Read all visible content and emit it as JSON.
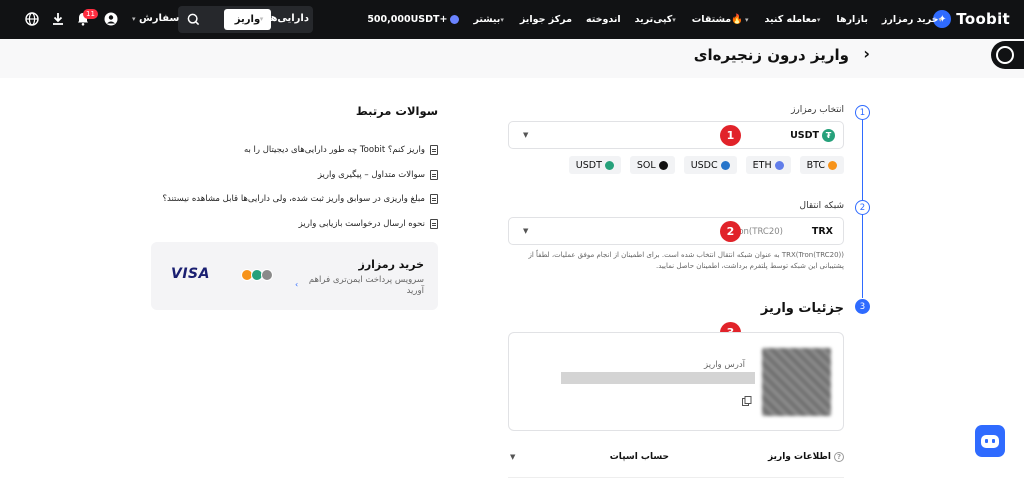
{
  "header": {
    "brand": "Toobit",
    "nav": [
      {
        "label": "خرید رمزارز",
        "caret": true
      },
      {
        "label": "بازارها",
        "caret": false
      },
      {
        "label": "معامله کنید",
        "caret": true
      },
      {
        "label": "مشتقات",
        "caret": true,
        "fire": true
      },
      {
        "label": "کپی‌ترید",
        "caret": true
      },
      {
        "label": "اندوخته",
        "caret": false
      },
      {
        "label": "مرکز جوایز",
        "caret": false
      },
      {
        "label": "بیشتر",
        "caret": true
      }
    ],
    "balance": "500,000USDT+",
    "deposit_button": "واریز",
    "assets_label": "دارایی‌ها",
    "orders_label": "سفارش",
    "notification_count": "11"
  },
  "page": {
    "title": "واریز درون زنجیره‌ای",
    "steps": [
      "1",
      "2",
      "3"
    ],
    "coin_label": "انتخاب رمزارز",
    "selected_coin": "USDT",
    "quick_coins": [
      {
        "label": "BTC",
        "color": "#f7931a"
      },
      {
        "label": "ETH",
        "color": "#627eea"
      },
      {
        "label": "USDC",
        "color": "#2775ca"
      },
      {
        "label": "SOL",
        "color": "#111111"
      },
      {
        "label": "USDT",
        "color": "#26a17b"
      }
    ],
    "network_label": "شبکه انتقال",
    "selected_network": "TRX",
    "selected_network_sub": "Tron(TRC20)",
    "network_notice": "TRX(Tron(TRC20)) به عنوان شبکه انتقال انتخاب شده است. برای اطمینان از انجام موفق عملیات، لطفاً از پشتیبانی این شبکه توسط پلتفرم برداشت، اطمینان حاصل نمایید.",
    "details_title": "جزئیات واریز",
    "address_label": "آدرس واریز",
    "info_label": "اطلاعات واریز",
    "info_value": "حساب اسپات",
    "markers": [
      "1",
      "2",
      "3"
    ]
  },
  "faq": {
    "title": "سوالات مرتبط",
    "items": [
      "چه طور دارایی‌های دیجیتال را به Toobit واریز کنم؟",
      "سوالات متداول – پیگیری واریز",
      "مبلغ واریزی در سوابق واریز ثبت شده، ولی دارایی‌ها قابل مشاهده نیستند؟",
      "نحوه ارسال درخواست بازیابی واریز"
    ]
  },
  "buy_card": {
    "title": "خرید رمزارز",
    "subtitle": "سرویس پرداخت ایمن‌تری فراهم آورید",
    "brand": "VISA",
    "coin_colors": [
      "#f7931a",
      "#26a17b",
      "#8a8a8a"
    ]
  },
  "icons": {
    "accent": "#2f6bff",
    "marker": "#e1232a"
  }
}
